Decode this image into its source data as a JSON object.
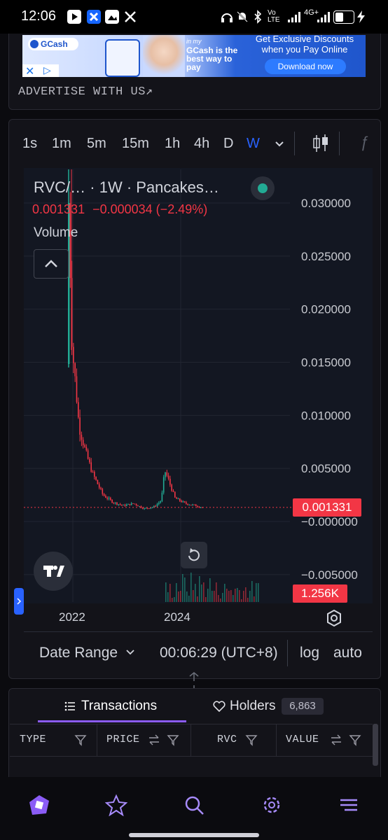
{
  "status_bar": {
    "time": "12:06",
    "network": "4G+",
    "volte": "Vo LTE",
    "battery": "40"
  },
  "ad": {
    "brand": "GCash",
    "tagline_top": "in my",
    "tagline": "GCash is the best way to pay",
    "headline": "Get Exclusive Discounts when you Pay Online",
    "cta": "Download now",
    "advertise_link": "ADVERTISE WITH US↗"
  },
  "chart": {
    "timeframes": [
      "1s",
      "1m",
      "5m",
      "15m",
      "1h",
      "4h",
      "D",
      "W"
    ],
    "active_timeframe": "W",
    "legend": {
      "title": "RVC/… · 1W · Pancakes…",
      "close": "0.001331",
      "change": "−0.000034 (−2.49%)",
      "volume_label": "Volume"
    },
    "price_tag": "0.001331",
    "volume_tag": "1.256K",
    "y_ticks": [
      "0.030000",
      "0.025000",
      "0.020000",
      "0.015000",
      "0.010000",
      "0.005000",
      "−0.000000",
      "−0.005000"
    ],
    "x_ticks": [
      "2022",
      "2024"
    ],
    "footer": {
      "date_range": "Date Range",
      "clock": "00:06:29 (UTC+8)",
      "log": "log",
      "auto": "auto"
    },
    "colors": {
      "up": "#22ab94",
      "down": "#f23645",
      "accent": "#2962ff"
    }
  },
  "chart_data": {
    "type": "line",
    "title": "RVC/… · 1W · Pancakes…",
    "xlabel": "",
    "ylabel": "",
    "ylim": [
      -0.0065,
      0.033
    ],
    "x_tick_labels": [
      "2022",
      "2024"
    ],
    "series": [
      {
        "x": [
          "2021-11",
          "2021-12",
          "2022-01",
          "2022-02",
          "2022-04",
          "2022-06",
          "2022-09",
          "2022-12",
          "2023-03",
          "2023-06",
          "2023-09",
          "2023-12",
          "2024-02",
          "2024-03",
          "2024-04",
          "2024-06",
          "2024-09",
          "2024-12",
          "2025-02"
        ],
        "values": [
          0.03,
          0.0165,
          0.013,
          0.009,
          0.0065,
          0.0045,
          0.0025,
          0.0018,
          0.0015,
          0.0017,
          0.0012,
          0.0014,
          0.002,
          0.0048,
          0.004,
          0.0022,
          0.0017,
          0.0015,
          0.00133
        ]
      }
    ],
    "last_price": 0.001331,
    "last_volume": "1.256K"
  },
  "tabs": {
    "transactions": "Transactions",
    "holders": "Holders",
    "holders_count": "6,863"
  },
  "table": {
    "columns": [
      "TYPE",
      "PRICE",
      "RVC",
      "VALUE"
    ]
  }
}
